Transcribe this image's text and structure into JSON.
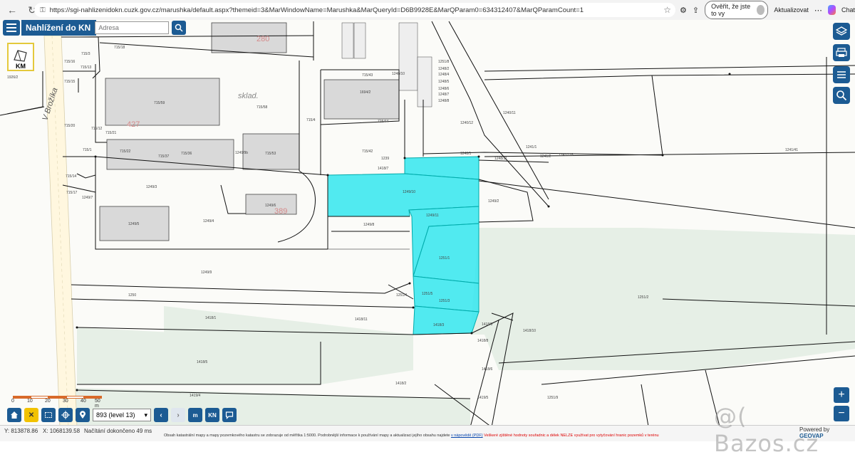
{
  "browser": {
    "url": "https://sgi-nahlizenidokn.cuzk.gov.cz/marushka/default.aspx?themeid=3&MarWindowName=Marushka&MarQueryId=D6B9928E&MarQParam0=634312407&MarQParamCount=1",
    "verify_label": "Ověřit, že jste to vy",
    "update_label": "Aktualizovat",
    "chat_label": "Chat"
  },
  "app": {
    "title": "Nahlížení do KN",
    "search_placeholder": "Adresa",
    "km_label": "KM"
  },
  "map": {
    "street_label": "V Brožíka",
    "sklad_label": "sklad.",
    "big_numbers": [
      "280",
      "427",
      "389"
    ],
    "parcels": [
      "1926/2",
      "715/18",
      "715/3",
      "715/16",
      "715/13",
      "715/15",
      "715/59",
      "715/58",
      "715/20",
      "715/21",
      "715/12",
      "715/22",
      "715/37",
      "715/36",
      "715/53",
      "715/1",
      "715/14",
      "715/17",
      "1249/7",
      "1249/3",
      "1249/5",
      "1249/4",
      "1249/6",
      "1249/2",
      "1249/8",
      "1249/9",
      "1249/10",
      "1249/11",
      "1251/1",
      "1251/2",
      "1251/3",
      "1251/4",
      "1251/5",
      "1250",
      "1418/3",
      "1418/1",
      "1418/5",
      "1419/4",
      "1418/2",
      "1418/8",
      "1418/9",
      "1418/10",
      "1418/11",
      "1239",
      "1240/12",
      "1248/1",
      "1248/11",
      "1241/2",
      "1241/118",
      "1241/1",
      "1241/41",
      "1240/11",
      "715/42",
      "715/44",
      "715/43",
      "1694/2",
      "1248/10",
      "1248/2",
      "1248/4",
      "1248/5",
      "1248/6",
      "1248/7",
      "1248/8",
      "1251/8",
      "715/4",
      "1249/9b",
      "1418/6",
      "1419/5",
      "1418/7",
      "1251/9"
    ]
  },
  "bottom": {
    "level_label": "893 (level 13)",
    "kn_label": "KN",
    "m_label": "m",
    "scale_labels": [
      "0",
      "10",
      "20",
      "30",
      "40",
      "50 m"
    ]
  },
  "status": {
    "y_coord": "Y: 813878.86",
    "x_coord": "X: 1068139.58",
    "load_text": "Načítání dokončeno 49 ms",
    "notice_text": "Obsah katastrální mapy a mapy pozemkového katastru se zobrazuje od měřítka 1:5000. Podrobnější informace k používání mapy a aktualizaci jejího obsahu najdete",
    "notice_link": "v nápovědě (PDF)",
    "notice_red": "Veškeré zjištěné hodnoty souřadnic a délek NELZE využívat pro vytyčování hranic pozemků v terénu",
    "powered_prefix": "Powered by",
    "powered_brand": "GEOVAP"
  },
  "watermark": "@( Bazos.cz"
}
